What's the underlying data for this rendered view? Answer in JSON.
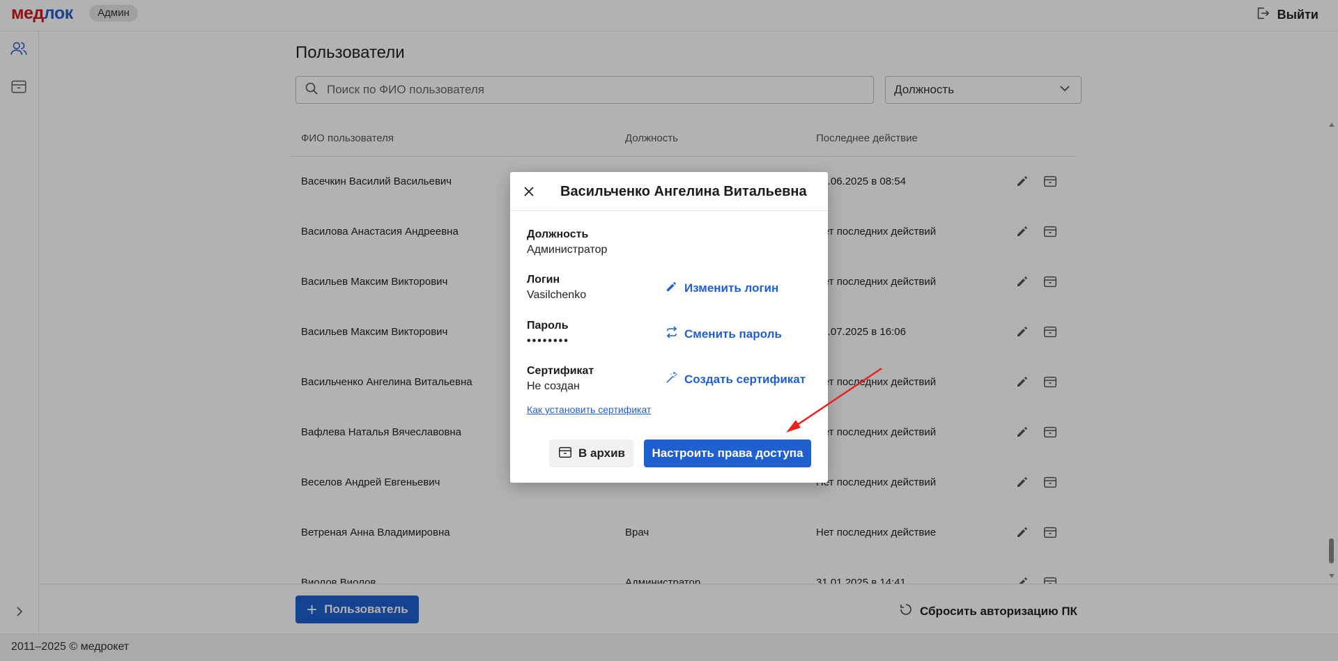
{
  "header": {
    "logo_part1": "мед",
    "logo_part2": "лок",
    "role_badge": "Админ",
    "logout_label": "Выйти"
  },
  "main": {
    "title": "Пользователи",
    "search_placeholder": "Поиск по ФИО пользователя",
    "position_filter": "Должность"
  },
  "table": {
    "headers": {
      "name": "ФИО пользователя",
      "position": "Должность",
      "last_action": "Последнее действие"
    },
    "rows": [
      {
        "name": "Васечкин Василий Васильевич",
        "position": "",
        "last_action": "10.06.2025 в 08:54"
      },
      {
        "name": "Василова Анастасия Андреевна",
        "position": "",
        "last_action": "Нет последних действий"
      },
      {
        "name": "Васильев Максим Викторович",
        "position": "",
        "last_action": "Нет последних действий"
      },
      {
        "name": "Васильев Максим Викторович",
        "position": "",
        "last_action": "31.07.2025 в 16:06"
      },
      {
        "name": "Васильченко Ангелина Витальевна",
        "position": "",
        "last_action": "Нет последних действий"
      },
      {
        "name": "Вафлева Наталья Вячеславовна",
        "position": "",
        "last_action": "Нет последних действий"
      },
      {
        "name": "Веселов Андрей Евгеньевич",
        "position": "",
        "last_action": "Нет последних действий"
      },
      {
        "name": "Ветреная Анна Владимировна",
        "position": "Врач",
        "last_action": "Нет последних действие"
      },
      {
        "name": "Виолов Виолов",
        "position": "Администратор",
        "last_action": "31.01.2025 в 14:41"
      }
    ]
  },
  "bottom": {
    "add_user_label": "Пользователь",
    "reset_auth_label": "Сбросить авторизацию ПК"
  },
  "footer": {
    "copyright": "2011–2025 © медрокет"
  },
  "modal": {
    "title": "Васильченко Ангелина Витальевна",
    "position_label": "Должность",
    "position_value": "Администратор",
    "login_label": "Логин",
    "login_value": "Vasilchenko",
    "password_label": "Пароль",
    "password_value": "••••••••",
    "certificate_label": "Сертификат",
    "certificate_value": "Не создан",
    "change_login": "Изменить логин",
    "change_password": "Сменить пароль",
    "create_certificate": "Создать сертификат",
    "how_to_install": "Как установить сертификат",
    "archive_button": "В архив",
    "access_button": "Настроить права доступа"
  },
  "colors": {
    "accent": "#1f5fd0",
    "logo_red": "#c8191e",
    "annotation_arrow": "#e8211d"
  }
}
